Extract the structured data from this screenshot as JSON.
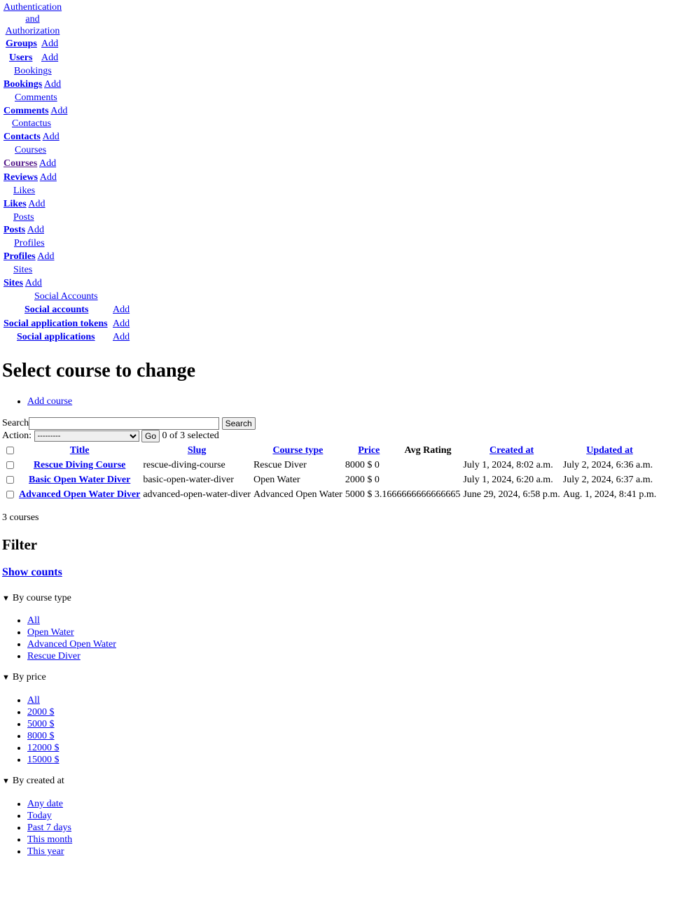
{
  "nav": {
    "auth": {
      "caption": "Authentication and Authorization",
      "rows": [
        {
          "name": "Groups",
          "add": "Add"
        },
        {
          "name": "Users",
          "add": "Add"
        }
      ]
    },
    "bookings": {
      "caption": "Bookings",
      "rows": [
        {
          "name": "Bookings",
          "add": "Add"
        }
      ]
    },
    "comments": {
      "caption": "Comments",
      "rows": [
        {
          "name": "Comments",
          "add": "Add"
        }
      ]
    },
    "contactus": {
      "caption": "Contactus",
      "rows": [
        {
          "name": "Contacts",
          "add": "Add"
        }
      ]
    },
    "courses": {
      "caption": "Courses",
      "rows": [
        {
          "name": "Courses",
          "add": "Add"
        },
        {
          "name": "Reviews",
          "add": "Add"
        }
      ]
    },
    "likes": {
      "caption": "Likes",
      "rows": [
        {
          "name": "Likes",
          "add": "Add"
        }
      ]
    },
    "posts": {
      "caption": "Posts",
      "rows": [
        {
          "name": "Posts",
          "add": "Add"
        }
      ]
    },
    "profiles": {
      "caption": "Profiles",
      "rows": [
        {
          "name": "Profiles",
          "add": "Add"
        }
      ]
    },
    "sites": {
      "caption": "Sites",
      "rows": [
        {
          "name": "Sites",
          "add": "Add"
        }
      ]
    },
    "social": {
      "caption": "Social Accounts",
      "rows": [
        {
          "name": "Social accounts",
          "add": "Add"
        },
        {
          "name": "Social application tokens",
          "add": "Add"
        },
        {
          "name": "Social applications",
          "add": "Add"
        }
      ]
    }
  },
  "page": {
    "title": "Select course to change",
    "add_course": "Add course",
    "search_img_alt": "Search",
    "search_value": "",
    "search_button": "Search",
    "action_label": "Action:",
    "action_selected": "---------",
    "go_button": "Go",
    "selected_count": "0 of 3 selected",
    "result_count": "3 courses"
  },
  "table": {
    "headers": {
      "title": "Title",
      "slug": "Slug",
      "course_type": "Course type",
      "price": "Price",
      "avg_rating": "Avg Rating",
      "created_at": "Created at",
      "updated_at": "Updated at"
    },
    "rows": [
      {
        "title": "Rescue Diving Course",
        "slug": "rescue-diving-course",
        "course_type": "Rescue Diver",
        "price": "8000 $",
        "avg_rating": "0",
        "created_at": "July 1, 2024, 8:02 a.m.",
        "updated_at": "July 2, 2024, 6:36 a.m."
      },
      {
        "title": "Basic Open Water Diver",
        "slug": "basic-open-water-diver",
        "course_type": "Open Water",
        "price": "2000 $",
        "avg_rating": "0",
        "created_at": "July 1, 2024, 6:20 a.m.",
        "updated_at": "July 2, 2024, 6:37 a.m."
      },
      {
        "title": "Advanced Open Water Diver",
        "slug": "advanced-open-water-diver",
        "course_type": "Advanced Open Water",
        "price": "5000 $",
        "avg_rating": "3.1666666666666665",
        "created_at": "June 29, 2024, 6:58 p.m.",
        "updated_at": "Aug. 1, 2024, 8:41 p.m."
      }
    ]
  },
  "filter": {
    "heading": "Filter",
    "show_counts": "Show counts",
    "groups": [
      {
        "label": "By course type",
        "items": [
          "All",
          "Open Water",
          "Advanced Open Water",
          "Rescue Diver"
        ]
      },
      {
        "label": "By price",
        "items": [
          "All",
          "2000 $",
          "5000 $",
          "8000 $",
          "12000 $",
          "15000 $"
        ]
      },
      {
        "label": "By created at",
        "items": [
          "Any date",
          "Today",
          "Past 7 days",
          "This month",
          "This year"
        ]
      }
    ]
  }
}
